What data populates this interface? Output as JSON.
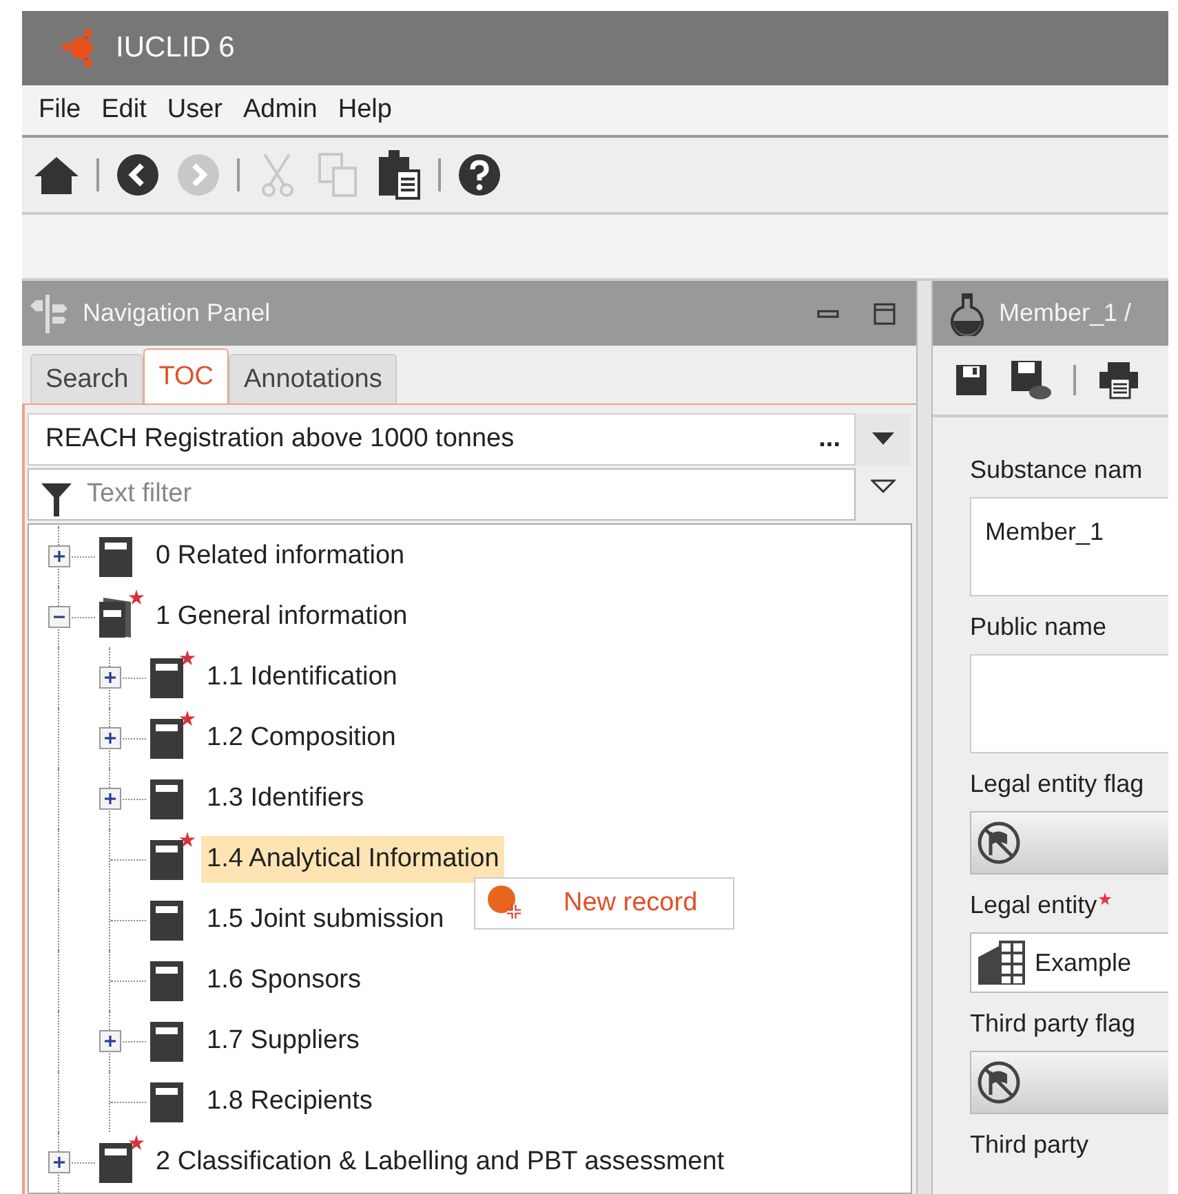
{
  "app": {
    "title": "IUCLID 6"
  },
  "menu": [
    "File",
    "Edit",
    "User",
    "Admin",
    "Help"
  ],
  "toolbar": [
    {
      "disabled": false
    },
    {
      "disabled": false
    },
    {
      "disabled": true
    },
    {
      "disabled": true
    },
    {
      "disabled": true
    },
    {
      "disabled": false
    },
    {
      "disabled": false
    }
  ],
  "navigation_panel": {
    "title": "Navigation Panel",
    "tabs": [
      {
        "label": "Search",
        "selected": false
      },
      {
        "label": "TOC",
        "selected": true
      },
      {
        "label": "Annotations",
        "selected": false
      }
    ],
    "template": {
      "value": "REACH Registration above 1000 tonnes",
      "more": "..."
    },
    "filter": {
      "placeholder": "Text filter"
    },
    "tree": [
      {
        "label": "0 Related information",
        "kind": "branch",
        "expanded": false,
        "required": false,
        "selected": false
      },
      {
        "label": "1 General information",
        "kind": "branch",
        "expanded": true,
        "required": true,
        "selected": false,
        "children": [
          {
            "label": "1.1 Identification",
            "kind": "branch",
            "expanded": false,
            "required": true,
            "selected": false
          },
          {
            "label": "1.2 Composition",
            "kind": "branch",
            "expanded": false,
            "required": true,
            "selected": false
          },
          {
            "label": "1.3 Identifiers",
            "kind": "branch",
            "expanded": false,
            "required": false,
            "selected": false
          },
          {
            "label": "1.4 Analytical Information",
            "kind": "leaf",
            "required": true,
            "selected": true
          },
          {
            "label": "1.5 Joint submission",
            "kind": "leaf",
            "required": false,
            "selected": false
          },
          {
            "label": "1.6 Sponsors",
            "kind": "leaf",
            "required": false,
            "selected": false
          },
          {
            "label": "1.7 Suppliers",
            "kind": "branch",
            "expanded": false,
            "required": false,
            "selected": false
          },
          {
            "label": "1.8 Recipients",
            "kind": "leaf",
            "required": false,
            "selected": false
          }
        ]
      },
      {
        "label": "2 Classification & Labelling and PBT assessment",
        "kind": "branch",
        "expanded": false,
        "required": true,
        "selected": false
      }
    ],
    "context_menu": {
      "items": [
        {
          "label": "New record"
        }
      ]
    }
  },
  "editor": {
    "title": "Member_1 /",
    "fields": [
      {
        "kind": "text",
        "label": "Substance nam",
        "value": "Member_1"
      },
      {
        "kind": "text",
        "label": "Public name"
      },
      {
        "kind": "flag",
        "label": "Legal entity flag"
      },
      {
        "kind": "entity",
        "label": "Legal entity",
        "required": true,
        "value": "Example"
      },
      {
        "kind": "flag",
        "label": "Third party flag"
      },
      {
        "kind": "label",
        "label": "Third party"
      }
    ]
  }
}
